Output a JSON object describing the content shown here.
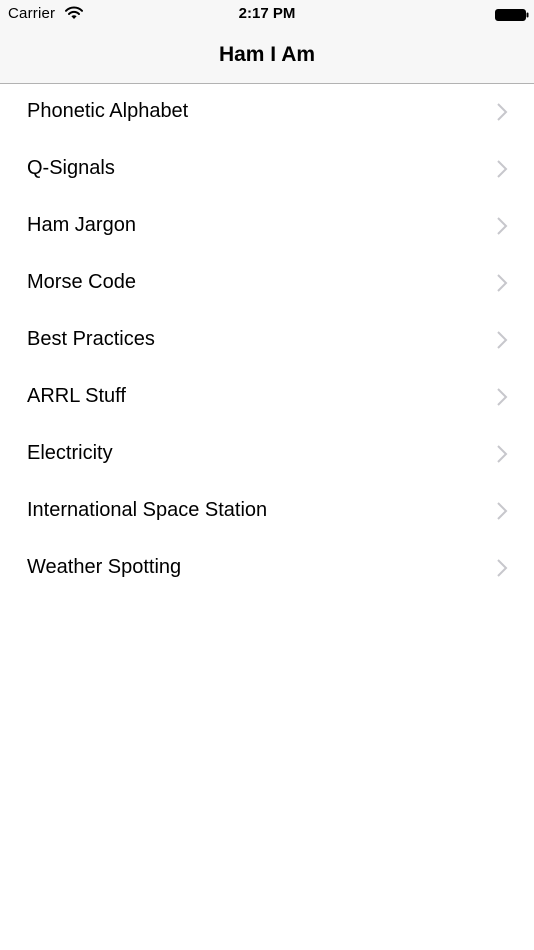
{
  "status_bar": {
    "carrier": "Carrier",
    "time": "2:17 PM",
    "wifi_icon": "wifi-icon",
    "battery_icon": "battery-icon"
  },
  "nav": {
    "title": "Ham I Am"
  },
  "menu": {
    "items": [
      {
        "label": "Phonetic Alphabet"
      },
      {
        "label": "Q-Signals"
      },
      {
        "label": "Ham Jargon"
      },
      {
        "label": "Morse Code"
      },
      {
        "label": "Best Practices"
      },
      {
        "label": "ARRL Stuff"
      },
      {
        "label": "Electricity"
      },
      {
        "label": "International Space Station"
      },
      {
        "label": "Weather Spotting"
      }
    ],
    "chevron_icon": "chevron-right-icon",
    "chevron_color": "#c7c7cc"
  },
  "colors": {
    "nav_background": "#f7f7f7",
    "separator": "#b2b2b2",
    "text": "#000000"
  }
}
